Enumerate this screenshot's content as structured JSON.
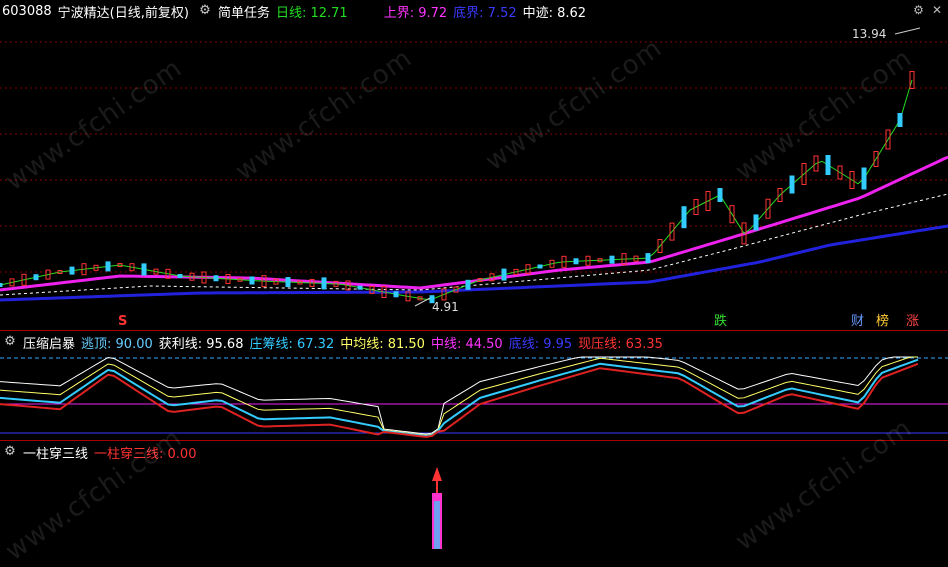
{
  "main": {
    "code": "603088",
    "name": "宁波精达",
    "mode": "(日线,前复权)",
    "indicator_name": "简单任务",
    "items": [
      {
        "label": "日线: 12.71",
        "color": "#22dd22"
      },
      {
        "label": "上界: 9.72",
        "color": "#ff33ff"
      },
      {
        "label": "底界: 7.52",
        "color": "#3a3aff"
      },
      {
        "label": "中迹: 8.62",
        "color": "#ffffff"
      }
    ],
    "high_label": "13.94",
    "low_label": "4.91",
    "badges": {
      "s": "S",
      "diedie": "跌",
      "cai": "财",
      "bang": "榜",
      "zhang": "涨"
    }
  },
  "sub1": {
    "name": "压缩启暴",
    "items": [
      {
        "label": "逃顶: 90.00",
        "color": "#66ccff"
      },
      {
        "label": "获利线: 95.68",
        "color": "#ffffff"
      },
      {
        "label": "庄筹线: 67.32",
        "color": "#33ccff"
      },
      {
        "label": "中均线: 81.50",
        "color": "#ffff66"
      },
      {
        "label": "中线: 44.50",
        "color": "#ff33ff"
      },
      {
        "label": "底线: 9.95",
        "color": "#3a3aff"
      },
      {
        "label": "现压线: 63.35",
        "color": "#ff3333"
      }
    ]
  },
  "sub2": {
    "name": "一柱穿三线",
    "items": [
      {
        "label": "一柱穿三线: 0.00",
        "color": "#ff3333"
      }
    ]
  },
  "watermark": "www.cfchi.com"
}
